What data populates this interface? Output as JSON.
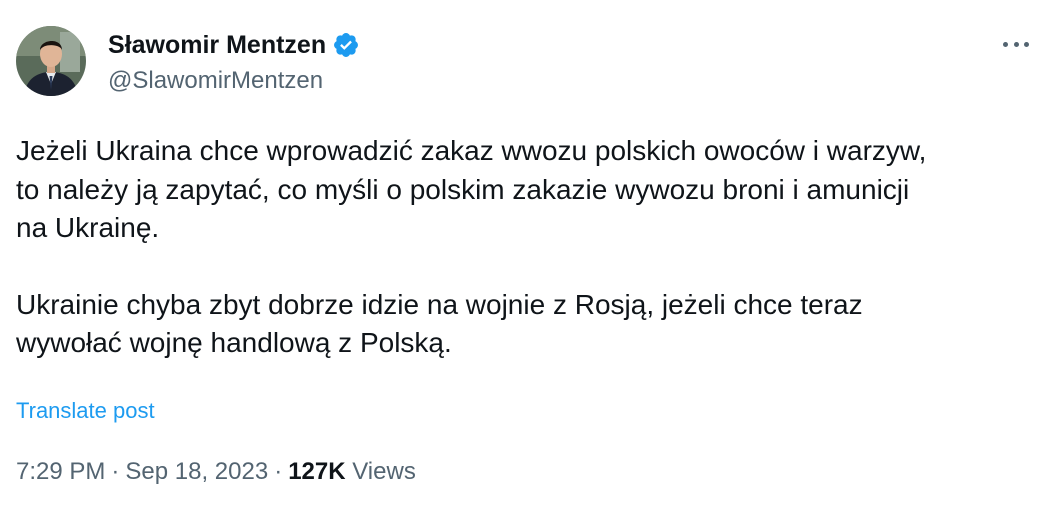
{
  "author": {
    "display_name": "Sławomir Mentzen",
    "handle": "@SlawomirMentzen",
    "verified": true,
    "verified_color": "#1d9bf0"
  },
  "post": {
    "paragraph1_lines": [
      "Jeżeli Ukraina chce wprowadzić zakaz wwozu polskich owoców i warzyw,",
      "to należy ją zapytać, co myśli o polskim zakazie wywozu broni i amunicji",
      "na Ukrainę."
    ],
    "paragraph2_lines": [
      "Ukrainie chyba zbyt dobrze idzie na wojnie z Rosją, jeżeli chce teraz",
      "wywołać wojnę handlową z Polską."
    ],
    "translate_label": "Translate post"
  },
  "meta": {
    "time": "7:29 PM",
    "separator": "·",
    "date": "Sep 18, 2023",
    "views_count": "127K",
    "views_label": "Views"
  },
  "icons": {
    "more": "more-horizontal-icon",
    "verified": "verified-badge-icon"
  },
  "colors": {
    "text_primary": "#0f1419",
    "text_secondary": "#536471",
    "link": "#1d9bf0"
  }
}
